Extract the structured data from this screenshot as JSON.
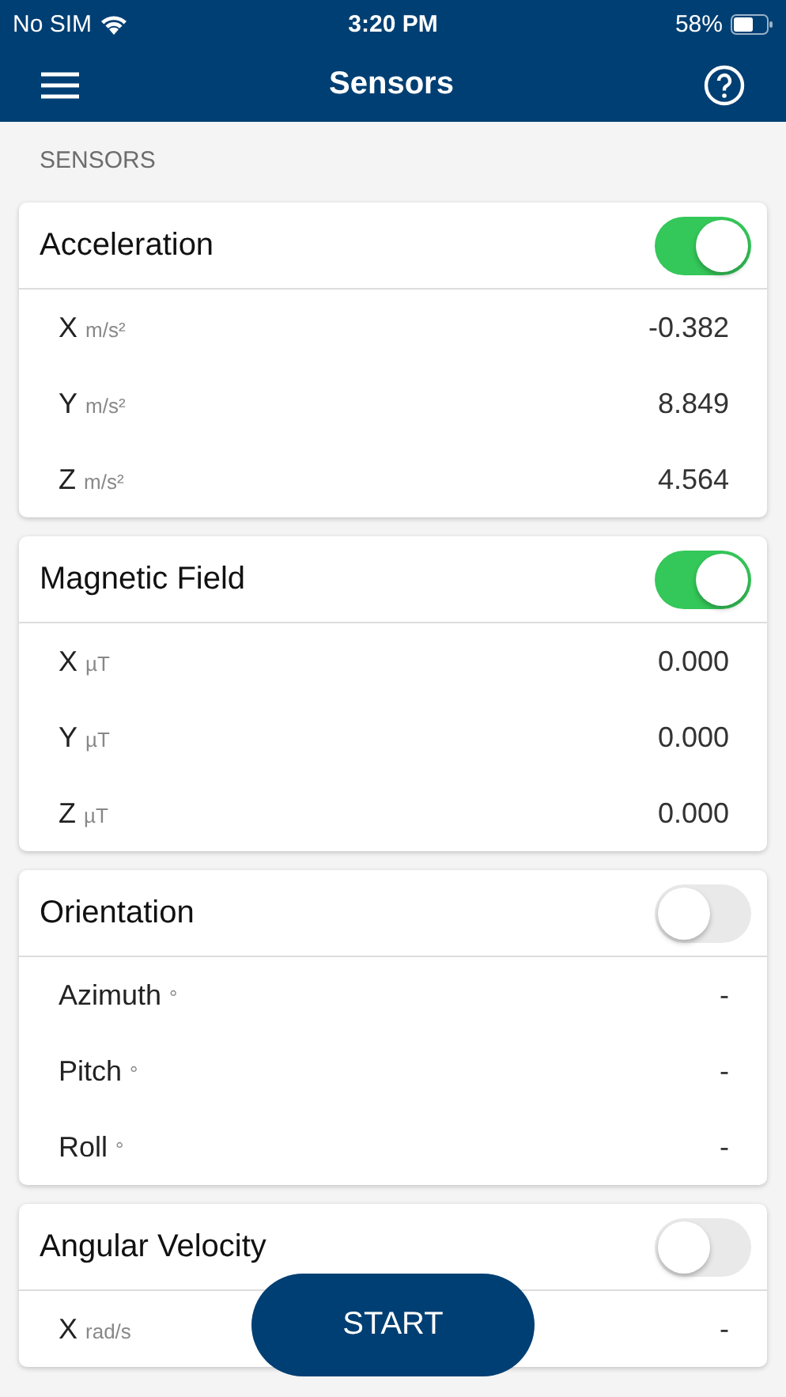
{
  "status_bar": {
    "carrier": "No SIM",
    "time": "3:20 PM",
    "battery": "58%"
  },
  "nav": {
    "title": "Sensors"
  },
  "section": {
    "title": "SENSORS"
  },
  "sensors": [
    {
      "name": "Acceleration",
      "on": true,
      "rows": [
        {
          "label": "X",
          "unit": "m/s²",
          "value": "-0.382"
        },
        {
          "label": "Y",
          "unit": "m/s²",
          "value": "8.849"
        },
        {
          "label": "Z",
          "unit": "m/s²",
          "value": "4.564"
        }
      ]
    },
    {
      "name": "Magnetic Field",
      "on": true,
      "rows": [
        {
          "label": "X",
          "unit": "µT",
          "value": "0.000"
        },
        {
          "label": "Y",
          "unit": "µT",
          "value": "0.000"
        },
        {
          "label": "Z",
          "unit": "µT",
          "value": "0.000"
        }
      ]
    },
    {
      "name": "Orientation",
      "on": false,
      "rows": [
        {
          "label": "Azimuth",
          "unit": "°",
          "value": "-"
        },
        {
          "label": "Pitch",
          "unit": "°",
          "value": "-"
        },
        {
          "label": "Roll",
          "unit": "°",
          "value": "-"
        }
      ]
    },
    {
      "name": "Angular Velocity",
      "on": false,
      "rows": [
        {
          "label": "X",
          "unit": "rad/s",
          "value": "-"
        }
      ]
    }
  ],
  "start_button": {
    "label": "START"
  }
}
